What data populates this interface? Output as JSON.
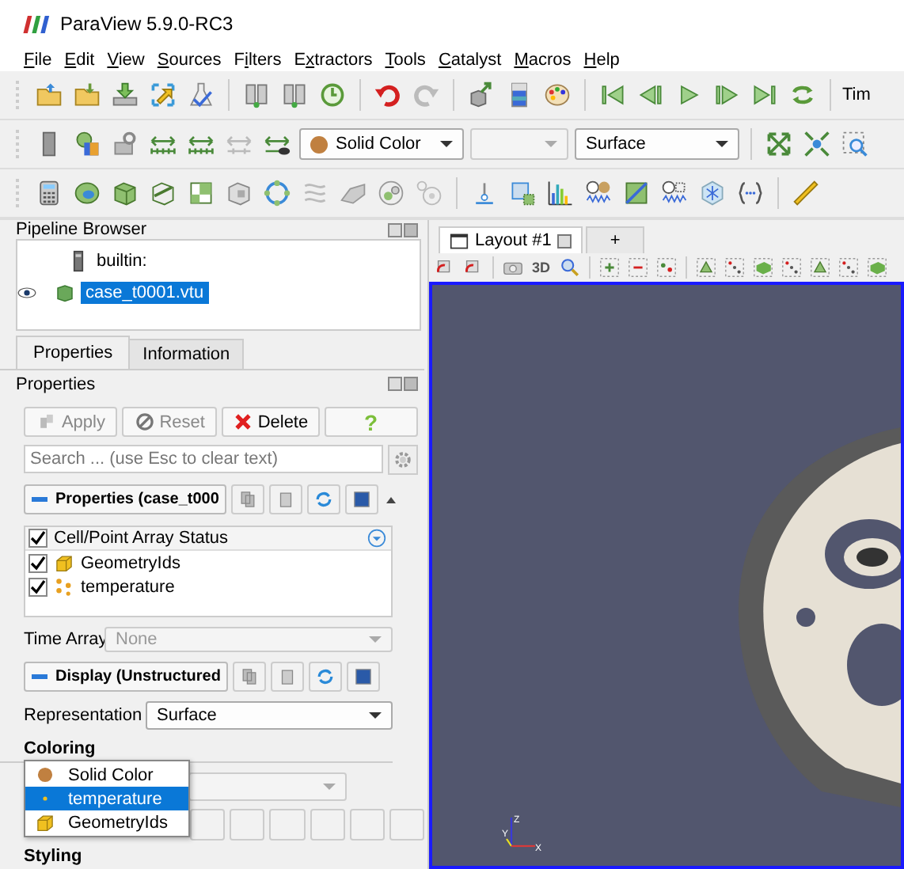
{
  "window": {
    "title": "ParaView 5.9.0-RC3"
  },
  "menu": [
    {
      "key": "F",
      "rest": "ile"
    },
    {
      "key": "E",
      "rest": "dit"
    },
    {
      "key": "V",
      "rest": "iew"
    },
    {
      "key": "S",
      "rest": "ources"
    },
    {
      "pre": "F",
      "key": "i",
      "rest": "lters"
    },
    {
      "pre": "E",
      "key": "x",
      "rest": "tractors"
    },
    {
      "key": "T",
      "rest": "ools"
    },
    {
      "key": "C",
      "rest": "atalyst"
    },
    {
      "key": "M",
      "rest": "acros"
    },
    {
      "key": "H",
      "rest": "elp"
    }
  ],
  "toolbar": {
    "time_label": "Tim",
    "coloring_combo": "Solid Color",
    "representation_combo": "Surface"
  },
  "pipeline_browser": {
    "title": "Pipeline Browser",
    "items": [
      {
        "kind": "server",
        "label": "builtin:",
        "selected": false
      },
      {
        "kind": "source",
        "label": "case_t0001.vtu",
        "selected": true,
        "visible": true
      }
    ]
  },
  "tabs": [
    {
      "label": "Properties",
      "selected": true
    },
    {
      "label": "Information",
      "selected": false
    }
  ],
  "properties": {
    "title": "Properties",
    "buttons": [
      {
        "kind": "apply",
        "label": "Apply",
        "disabled": true
      },
      {
        "kind": "reset",
        "label": "Reset",
        "disabled": true
      },
      {
        "kind": "delete",
        "label": "Delete",
        "disabled": false
      },
      {
        "kind": "help",
        "label": "?",
        "disabled": false
      }
    ],
    "search": {
      "placeholder": "Search ... (use Esc to clear text)"
    },
    "section_properties": "Properties (case_t000",
    "array_status": {
      "header": "Cell/Point Array Status",
      "checked": true,
      "arrays": [
        {
          "kind": "cell",
          "label": "GeometryIds",
          "checked": true
        },
        {
          "kind": "point",
          "label": "temperature",
          "checked": true
        }
      ]
    },
    "time_array": {
      "label": "Time Array",
      "value": "None"
    },
    "section_display": "Display (Unstructured",
    "representation": {
      "label": "Representation",
      "value": "Surface"
    },
    "coloring": {
      "label": "Coloring",
      "options": [
        {
          "kind": "solid",
          "label": "Solid Color",
          "selected": false
        },
        {
          "kind": "point",
          "label": "temperature",
          "selected": true
        },
        {
          "kind": "cell",
          "label": "GeometryIds",
          "selected": false
        }
      ]
    },
    "styling": "Styling"
  },
  "layout_tabs": [
    {
      "label": "Layout #1",
      "selected": true
    },
    {
      "label": "+",
      "selected": false
    }
  ],
  "view_toolbar": {
    "mode": "3D"
  },
  "axes": {
    "x": "X",
    "y": "Y",
    "z": "Z"
  }
}
